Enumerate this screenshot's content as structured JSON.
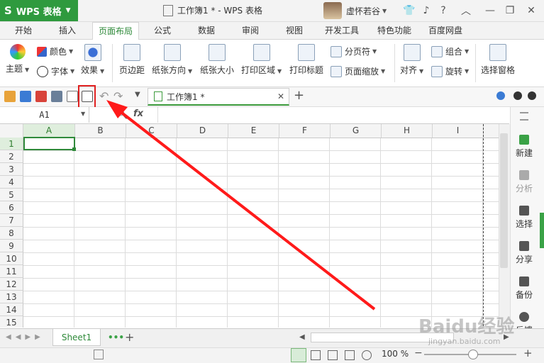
{
  "app": {
    "logo_text": "WPS 表格",
    "doc_title": "工作簿1 * - WPS 表格",
    "username": "虚怀若谷"
  },
  "ribbon_tabs": [
    "开始",
    "插入",
    "页面布局",
    "公式",
    "数据",
    "审阅",
    "视图",
    "开发工具",
    "特色功能",
    "百度网盘"
  ],
  "active_tab": "页面布局",
  "ribbon": {
    "theme": "主题",
    "colors": "颜色",
    "fonts": "字体",
    "effects": "效果",
    "margins": "页边距",
    "orientation": "纸张方向",
    "paper_size": "纸张大小",
    "print_area": "打印区域",
    "print_titles": "打印标题",
    "page_break": "分页符",
    "page_zoom": "页面缩放",
    "align": "对齐",
    "group": "组合",
    "rotate": "旋转",
    "selection_pane": "选择窗格"
  },
  "document_tab": {
    "label": "工作簿1 *"
  },
  "formula_bar": {
    "cell_ref": "A1",
    "fx": "fx"
  },
  "columns": [
    "A",
    "B",
    "C",
    "D",
    "E",
    "F",
    "G",
    "H",
    "I"
  ],
  "rows": [
    "1",
    "2",
    "3",
    "4",
    "5",
    "6",
    "7",
    "8",
    "9",
    "10",
    "11",
    "12",
    "13",
    "14",
    "15"
  ],
  "side_panel": [
    "新建",
    "分析",
    "选择",
    "分享",
    "备份",
    "反馈"
  ],
  "sheets": [
    "Sheet1"
  ],
  "status": {
    "zoom": "100 %"
  },
  "watermark": {
    "text": "Baidu经验",
    "url": "jingyan.baidu.com"
  }
}
